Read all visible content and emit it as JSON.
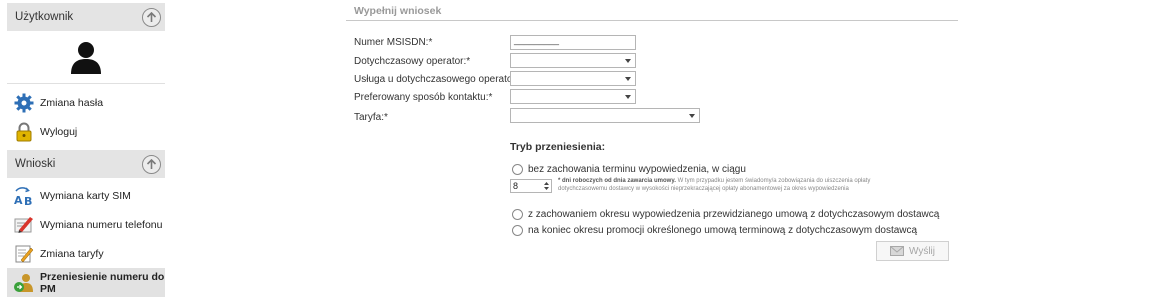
{
  "sidebar": {
    "user_section": {
      "title": "Użytkownik",
      "icon": "chevron-up-icon"
    },
    "user_items": [
      {
        "label": "Zmiana hasła",
        "icon": "gear-icon"
      },
      {
        "label": "Wyloguj",
        "icon": "padlock-icon"
      }
    ],
    "requests_section": {
      "title": "Wnioski",
      "icon": "chevron-up-icon"
    },
    "request_items": [
      {
        "label": "Wymiana karty SIM",
        "icon": "ab-swap-icon"
      },
      {
        "label": "Wymiana numeru telefonu",
        "icon": "pencil-form-icon"
      },
      {
        "label": "Zmiana taryfy",
        "icon": "edit-document-icon"
      },
      {
        "label": "Przeniesienie numeru do PM",
        "icon": "user-transfer-icon",
        "active": true
      }
    ]
  },
  "form": {
    "title": "Wypełnij wniosek",
    "msisdn_label": "Numer MSISDN:*",
    "msisdn_value": "_________",
    "operator_label": "Dotychczasowy operator:*",
    "service_label": "Usługa u dotychczasowego operatora:*",
    "contact_label": "Preferowany sposób kontaktu:*",
    "tariff_label": "Taryfa:*",
    "transfer_mode_title": "Tryb przeniesienia:",
    "option1_label": "bez zachowania terminu wypowiedzenia, w ciągu",
    "days_value": "8",
    "fine_bold": "* dni roboczych od dnia zawarcia umowy.",
    "fine_text": "W tym przypadku jestem świadomy/a zobowiązania do uiszczenia opłaty dotychczasowemu dostawcy w wysokości nieprzekraczającej opłaty abonamentowej za okres wypowiedzenia",
    "option2_label": "z zachowaniem okresu wypowiedzenia przewidzianego umową z dotychczasowym dostawcą",
    "option3_label": "na koniec okresu promocji określonego umową terminową z dotychczasowym dostawcą",
    "submit_label": "Wyślij"
  },
  "colors": {
    "section_bg": "#e4e4e4",
    "active_bg": "#e2e2e2",
    "border": "#b5b5b5",
    "muted_text": "#999999"
  }
}
